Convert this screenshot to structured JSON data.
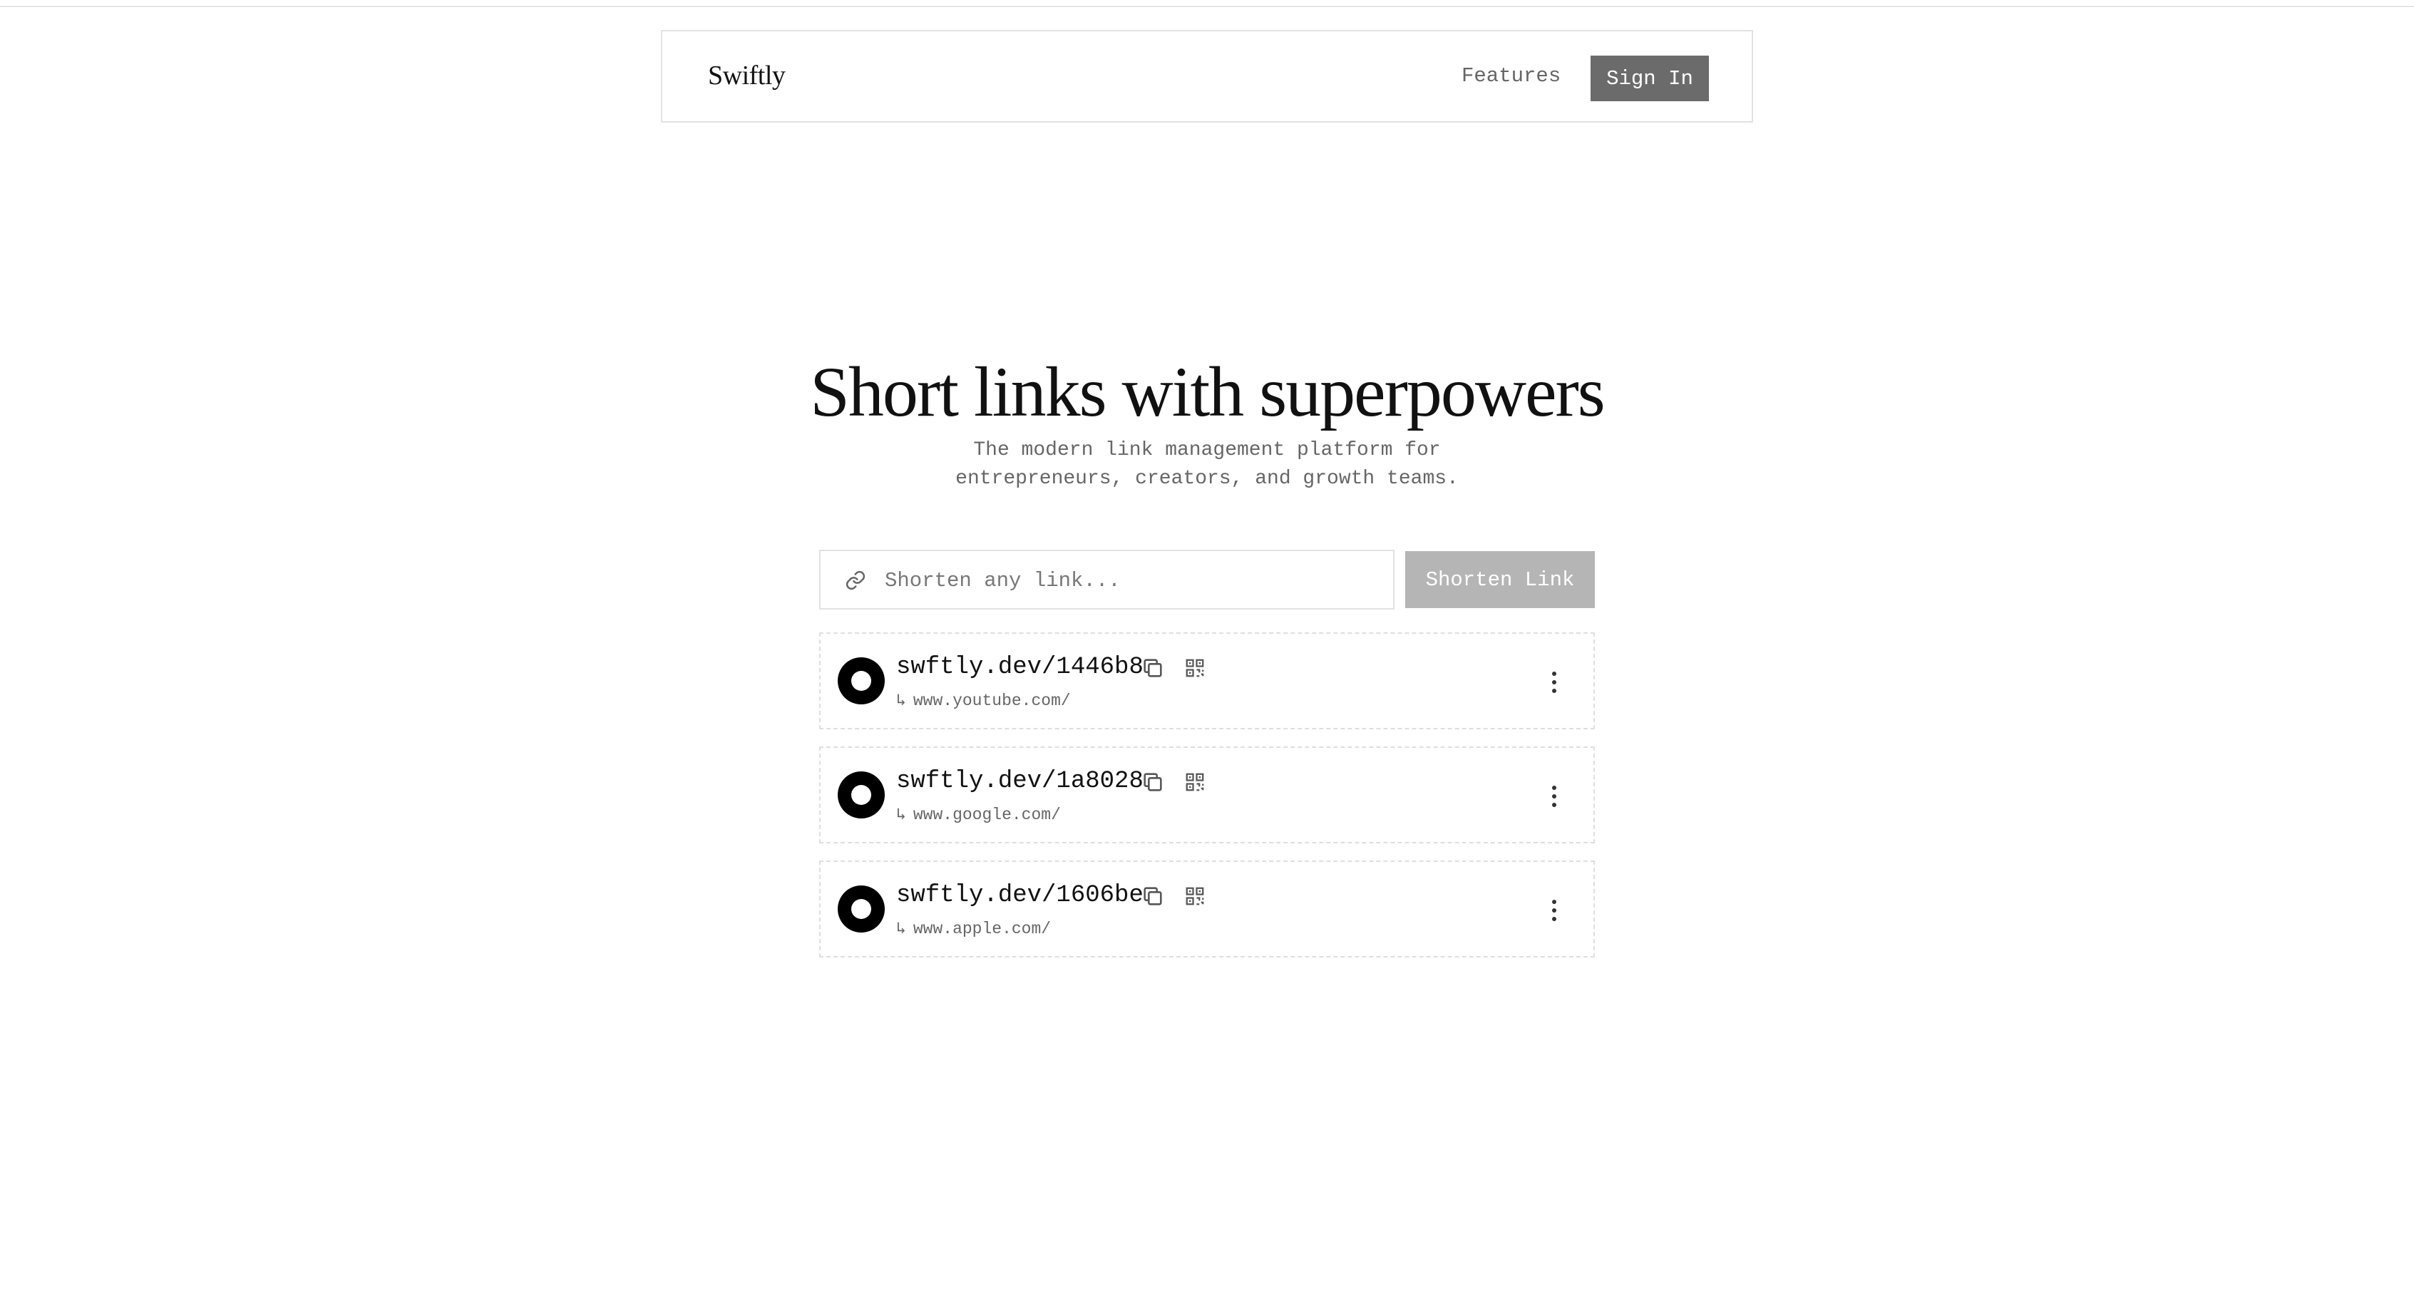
{
  "header": {
    "brand": "Swiftly",
    "nav_features": "Features",
    "sign_in": "Sign In"
  },
  "hero": {
    "title": "Short links with superpowers",
    "subtitle_line1": "The modern link management platform for",
    "subtitle_line2": "entrepreneurs, creators, and growth teams."
  },
  "shorten": {
    "placeholder": "Shorten any link...",
    "value": "",
    "button_label": "Shorten Link"
  },
  "links": [
    {
      "short": "swftly.dev/1446b8",
      "arrow": "↳",
      "destination": "www.youtube.com/"
    },
    {
      "short": "swftly.dev/1a8028",
      "arrow": "↳",
      "destination": "www.google.com/"
    },
    {
      "short": "swftly.dev/1606be",
      "arrow": "↳",
      "destination": "www.apple.com/"
    }
  ],
  "icons": {
    "input_icon": "link-icon",
    "card_logo": "site-logo",
    "copy": "copy-icon",
    "qr": "qr-code-icon",
    "menu": "more-vertical-icon"
  },
  "colors": {
    "sign_in_bg": "#6b6b6b",
    "shorten_button_bg": "#b5b5b5",
    "border": "#e2e2e2",
    "muted_text": "#666666"
  }
}
